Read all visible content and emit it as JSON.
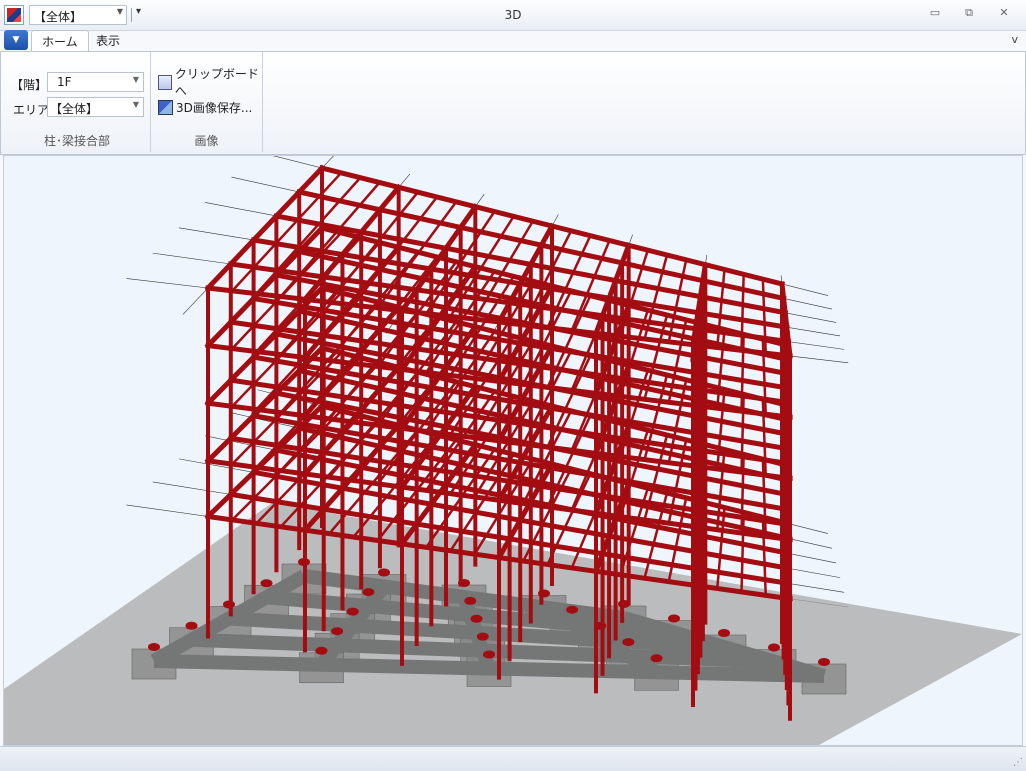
{
  "window": {
    "title": "3D",
    "minimize_glyph": "▭",
    "restore_glyph": "⧉",
    "close_glyph": "✕"
  },
  "quick_access": {
    "combo_value": "【全体】",
    "more_glyph": "▾"
  },
  "ribbon": {
    "app_menu_glyph": "▼",
    "tabs": [
      {
        "label": "ホーム",
        "active": true
      },
      {
        "label": "表示",
        "active": false
      }
    ],
    "collapse_glyph": "v",
    "groups": {
      "joint": {
        "label": "柱･梁接合部",
        "floor_label": "【階】",
        "floor_value": "1F",
        "area_label": "エリア",
        "area_value": "【全体】"
      },
      "image": {
        "label": "画像",
        "clipboard_label": "クリップボードへ",
        "save_label": "3D画像保存..."
      }
    }
  },
  "viewport": {
    "frame_color": "#a30d12",
    "foundation_color": "#7a7a7a",
    "ground_color": "#a8a8a8",
    "background_color": "#eef5fc"
  },
  "icons": {
    "app": "app-logo-icon",
    "clipboard": "clipboard-copy-icon",
    "save_image": "save-image-icon"
  }
}
